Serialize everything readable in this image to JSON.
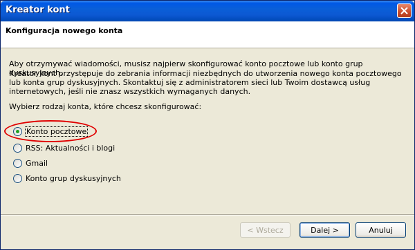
{
  "window": {
    "title": "Kreator kont",
    "close_icon": "close-icon"
  },
  "header": {
    "title": "Konfiguracja nowego konta"
  },
  "content": {
    "paragraph1": "Aby otrzymywać wiadomości, musisz najpierw skonfigurować konto pocztowe lub konto grup dyskusyjnych.",
    "paragraph2": "Kreator kont przystępuje do zebrania informacji niezbędnych do utworzenia nowego konta pocztowego lub konta grup dyskusyjnych. Skontaktuj się z administratorem sieci lub Twoim dostawcą usług internetowych, jeśli nie znasz wszystkich wymaganych danych.",
    "paragraph3": "Wybierz rodzaj konta, które chcesz skonfigurować:",
    "options": [
      {
        "label": "Konto pocztowe",
        "selected": true
      },
      {
        "label": "RSS: Aktualności i blogi",
        "selected": false
      },
      {
        "label": "Gmail",
        "selected": false
      },
      {
        "label": "Konto grup dyskusyjnych",
        "selected": false
      }
    ]
  },
  "buttons": {
    "back": "< Wstecz",
    "next": "Dalej >",
    "cancel": "Anuluj"
  },
  "colors": {
    "highlight": "#e00000",
    "titlebar": "#0058e6"
  }
}
